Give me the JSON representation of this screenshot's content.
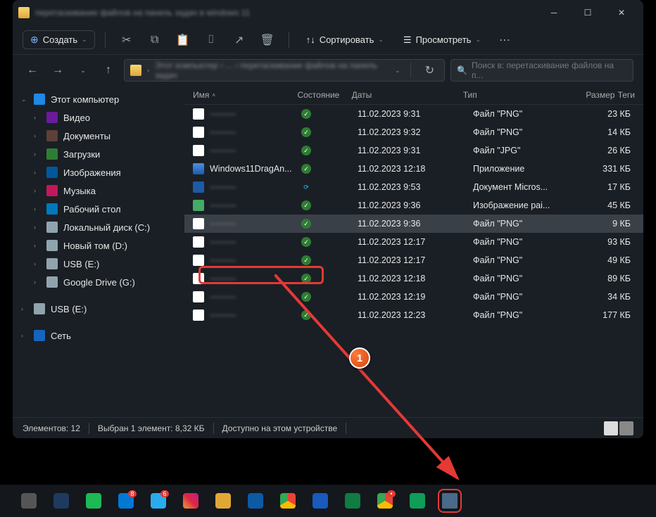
{
  "window": {
    "title": "перетаскивание файлов на панель задач в windows 11"
  },
  "toolbar": {
    "create_label": "Создать",
    "sort_label": "Сортировать",
    "view_label": "Просмотреть"
  },
  "navbar": {
    "path_text": "Этот компьютер › ... › перетаскивание файлов на панель задач",
    "path_dropdown": "⌄",
    "search_placeholder": "Поиск в: перетаскивание файлов на п..."
  },
  "sidebar": [
    {
      "label": "Этот компьютер",
      "ico": "ico-pc",
      "chev": true,
      "open": true,
      "indent": 0
    },
    {
      "label": "Видео",
      "ico": "ico-vid",
      "chev": true,
      "indent": 1
    },
    {
      "label": "Документы",
      "ico": "ico-doc",
      "chev": true,
      "indent": 1
    },
    {
      "label": "Загрузки",
      "ico": "ico-dl",
      "chev": true,
      "indent": 1
    },
    {
      "label": "Изображения",
      "ico": "ico-img",
      "chev": true,
      "indent": 1
    },
    {
      "label": "Музыка",
      "ico": "ico-mus",
      "chev": true,
      "indent": 1
    },
    {
      "label": "Рабочий стол",
      "ico": "ico-desk",
      "chev": true,
      "indent": 1
    },
    {
      "label": "Локальный диск (C:)",
      "ico": "ico-drive",
      "chev": true,
      "indent": 1
    },
    {
      "label": "Новый том (D:)",
      "ico": "ico-drive",
      "chev": true,
      "indent": 1
    },
    {
      "label": "USB (E:)",
      "ico": "ico-drive",
      "chev": true,
      "indent": 1
    },
    {
      "label": "Google Drive (G:)",
      "ico": "ico-drive",
      "chev": true,
      "indent": 1
    },
    {
      "label": "USB (E:)",
      "ico": "ico-drive",
      "chev": true,
      "indent": 0,
      "sepbefore": true
    },
    {
      "label": "Сеть",
      "ico": "ico-net",
      "chev": true,
      "indent": 0,
      "sepbefore": true
    }
  ],
  "columns": {
    "name": "Имя",
    "state": "Состояние",
    "date": "Даты",
    "type": "Тип",
    "size": "Размер",
    "tags": "Теги"
  },
  "files": [
    {
      "name": "———",
      "ico": "png",
      "state": "ok",
      "date": "11.02.2023 9:31",
      "type": "Файл \"PNG\"",
      "size": "23 КБ"
    },
    {
      "name": "———",
      "ico": "png",
      "state": "ok",
      "date": "11.02.2023 9:32",
      "type": "Файл \"PNG\"",
      "size": "14 КБ"
    },
    {
      "name": "———",
      "ico": "jpg",
      "state": "ok",
      "date": "11.02.2023 9:31",
      "type": "Файл \"JPG\"",
      "size": "26 КБ"
    },
    {
      "name": "Windows11DragAn...",
      "ico": "app",
      "state": "ok",
      "date": "11.02.2023 12:18",
      "type": "Приложение",
      "size": "331 КБ",
      "clear": true
    },
    {
      "name": "———",
      "ico": "docx",
      "state": "sync",
      "date": "11.02.2023 9:53",
      "type": "Документ Micros...",
      "size": "17 КБ"
    },
    {
      "name": "———",
      "ico": "img",
      "state": "ok",
      "date": "11.02.2023 9:36",
      "type": "Изображение раi...",
      "size": "45 КБ"
    },
    {
      "name": "———",
      "ico": "png",
      "state": "ok",
      "date": "11.02.2023 9:36",
      "type": "Файл \"PNG\"",
      "size": "9 КБ",
      "selected": true
    },
    {
      "name": "———",
      "ico": "png",
      "state": "ok",
      "date": "11.02.2023 12:17",
      "type": "Файл \"PNG\"",
      "size": "93 КБ"
    },
    {
      "name": "———",
      "ico": "png",
      "state": "ok",
      "date": "11.02.2023 12:17",
      "type": "Файл \"PNG\"",
      "size": "49 КБ"
    },
    {
      "name": "———",
      "ico": "png",
      "state": "ok",
      "date": "11.02.2023 12:18",
      "type": "Файл \"PNG\"",
      "size": "89 КБ"
    },
    {
      "name": "———",
      "ico": "png",
      "state": "ok",
      "date": "11.02.2023 12:19",
      "type": "Файл \"PNG\"",
      "size": "34 КБ"
    },
    {
      "name": "———",
      "ico": "png",
      "state": "ok",
      "date": "11.02.2023 12:23",
      "type": "Файл \"PNG\"",
      "size": "177 КБ"
    }
  ],
  "status": {
    "count": "Элементов: 12",
    "selection": "Выбран 1 элемент: 8,32 КБ",
    "availability": "Доступно на этом устройстве"
  },
  "taskbar": [
    {
      "name": "taskview",
      "bg": "#555"
    },
    {
      "name": "calculator",
      "bg": "#1e3a5f"
    },
    {
      "name": "spotify",
      "bg": "#1db954"
    },
    {
      "name": "skype",
      "bg": "#0078d4",
      "badge": "8"
    },
    {
      "name": "telegram",
      "bg": "#2aabee",
      "badge": "6"
    },
    {
      "name": "instagram",
      "bg": "linear-gradient(45deg,#f09433,#e6683c,#dc2743,#cc2366,#bc1888)"
    },
    {
      "name": "explorer",
      "bg": "#e0a737"
    },
    {
      "name": "edge",
      "bg": "#0c59a4"
    },
    {
      "name": "chrome1",
      "bg": "conic-gradient(#ea4335 0 120deg,#fbbc05 120deg 240deg,#34a853 240deg)"
    },
    {
      "name": "word",
      "bg": "#185abd"
    },
    {
      "name": "excel",
      "bg": "#107c41"
    },
    {
      "name": "chrome2",
      "bg": "conic-gradient(#ea4335 0 120deg,#fbbc05 120deg 240deg,#34a853 240deg)",
      "badge": "•"
    },
    {
      "name": "sheets",
      "bg": "#0f9d58"
    },
    {
      "name": "imageviewer",
      "bg": "#4a6a8a",
      "target": true
    }
  ],
  "marker": {
    "num": "1"
  }
}
